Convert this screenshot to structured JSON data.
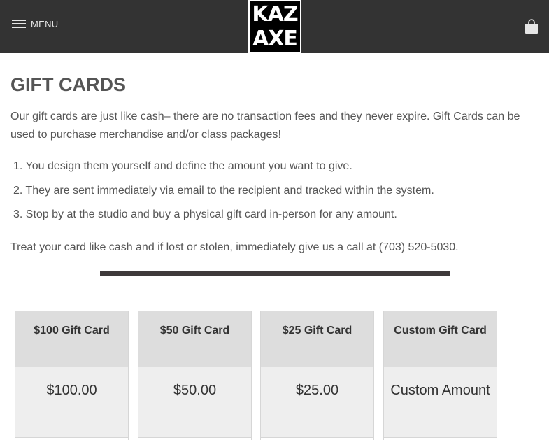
{
  "header": {
    "menu_label": "MENU",
    "logo_line1": "KAZ",
    "logo_line2": "AXE",
    "cart_icon": "shopping-bag-icon",
    "background_color": "#333333"
  },
  "page": {
    "title": "GIFT CARDS",
    "intro": "Our gift cards are just like cash– there are no transaction fees and they never expire.  Gift Cards can be used to purchase merchandise and/or class packages!",
    "steps": [
      "1. You design them yourself and define the amount you want to give.",
      "2. They are sent immediately via email to the recipient and tracked within the system.",
      "3. Stop by at the studio and buy a physical gift card in-person for any amount."
    ],
    "notice": "Treat your card like cash and if lost or stolen, immediately give us a call at (703) 520-5030."
  },
  "cards": [
    {
      "name": "$100 Gift Card",
      "price": "$100.00"
    },
    {
      "name": "$50 Gift Card",
      "price": "$50.00"
    },
    {
      "name": "$25 Gift Card",
      "price": "$25.00"
    },
    {
      "name": "Custom Gift Card",
      "price": "Custom Amount"
    }
  ]
}
